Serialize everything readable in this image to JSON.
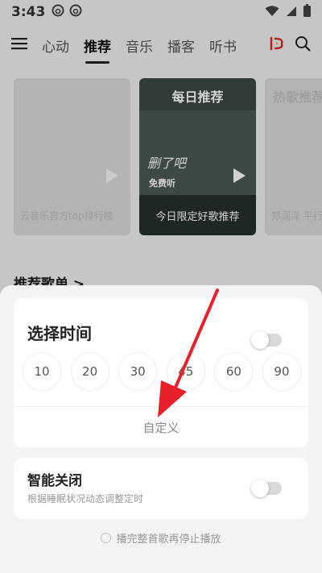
{
  "status_bar": {
    "time": "3:43",
    "icons": [
      "netease-icon",
      "netease-icon",
      "wifi-icon",
      "signal-icon",
      "battery-icon"
    ]
  },
  "nav": {
    "tabs": [
      {
        "label": "心动",
        "active": false
      },
      {
        "label": "推荐",
        "active": true
      },
      {
        "label": "音乐",
        "active": false
      },
      {
        "label": "播客",
        "active": false
      },
      {
        "label": "听书",
        "active": false
      }
    ],
    "icons": [
      "menu-icon",
      "live-icon",
      "search-icon"
    ]
  },
  "cards": {
    "left": {
      "caption": "云音乐官方top排行榜"
    },
    "center": {
      "title": "每日推荐",
      "handwriting": "删了吧",
      "badge": "免费听",
      "caption": "今日限定好歌推荐"
    },
    "right": {
      "title": "热歌推荐",
      "caption": "郑润泽 平行"
    }
  },
  "section": {
    "title": "推荐歌单 >"
  },
  "sleep_timer": {
    "title": "选择时间",
    "options": [
      "10",
      "20",
      "30",
      "45",
      "60",
      "90"
    ],
    "custom_label": "自定义",
    "toggle_on": false
  },
  "smart_close": {
    "title": "智能关闭",
    "subtitle": "根据睡眠状况动态调整定时",
    "toggle_on": false
  },
  "finish_song": {
    "label": "播完整首歌再停止播放",
    "checked": false
  },
  "colors": {
    "annotation_arrow": "#e8202a",
    "card_dark": "#3d4a44"
  }
}
